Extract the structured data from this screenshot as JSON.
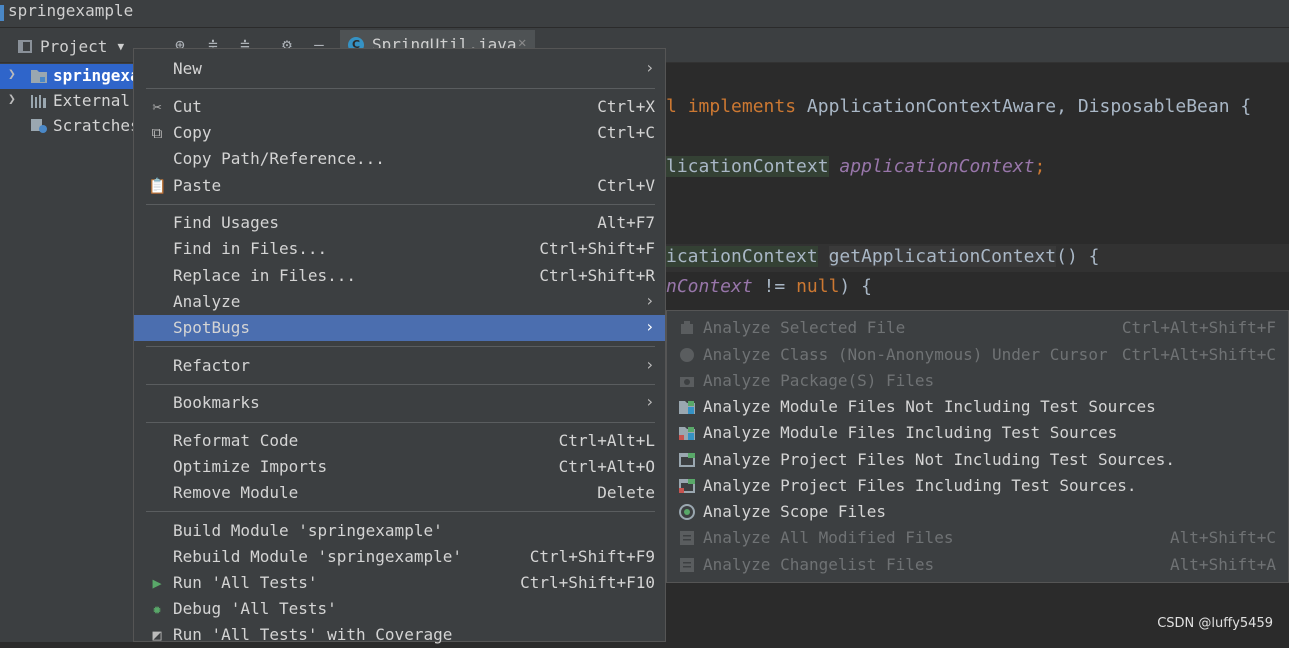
{
  "window": {
    "title": "springexample"
  },
  "toolbar": {
    "project_label": "Project"
  },
  "tab": {
    "icon_letter": "C",
    "name": "SpringUtil.java"
  },
  "tree": [
    {
      "label": "springexa",
      "selected": true
    },
    {
      "label": "External",
      "selected": false
    },
    {
      "label": "Scratches",
      "selected": false
    }
  ],
  "editor": {
    "line1": {
      "implements": "implements",
      "types": " ApplicationContextAware, DisposableBean {",
      "comma": ","
    },
    "line2": {
      "type": "licationContext",
      "field": "applicationContext",
      "semi": ";"
    },
    "line3": {
      "type": "icationContext",
      "method": "getApplicationContext",
      "rest": "() {"
    },
    "line4": {
      "field": "nContext",
      "op": " != ",
      "null": "null",
      "rest": ") {"
    }
  },
  "context_menu": {
    "new": {
      "label": "New"
    },
    "cut": {
      "label": "Cut",
      "shortcut": "Ctrl+X"
    },
    "copy": {
      "label": "Copy",
      "shortcut": "Ctrl+C"
    },
    "copy_path": {
      "label": "Copy Path/Reference..."
    },
    "paste": {
      "label": "Paste",
      "shortcut": "Ctrl+V"
    },
    "find_usages": {
      "label": "Find Usages",
      "shortcut": "Alt+F7"
    },
    "find_in_files": {
      "label": "Find in Files...",
      "shortcut": "Ctrl+Shift+F"
    },
    "replace_in_files": {
      "label": "Replace in Files...",
      "shortcut": "Ctrl+Shift+R"
    },
    "analyze": {
      "label": "Analyze"
    },
    "spotbugs": {
      "label": "SpotBugs"
    },
    "refactor": {
      "label": "Refactor"
    },
    "bookmarks": {
      "label": "Bookmarks"
    },
    "reformat": {
      "label": "Reformat Code",
      "shortcut": "Ctrl+Alt+L"
    },
    "optimize": {
      "label": "Optimize Imports",
      "shortcut": "Ctrl+Alt+O"
    },
    "remove_module": {
      "label": "Remove Module",
      "shortcut": "Delete"
    },
    "build_module": {
      "label": "Build Module 'springexample'"
    },
    "rebuild_module": {
      "label": "Rebuild Module 'springexample'",
      "shortcut": "Ctrl+Shift+F9"
    },
    "run_tests": {
      "label": "Run 'All Tests'",
      "shortcut": "Ctrl+Shift+F10"
    },
    "debug_tests": {
      "label": "Debug 'All Tests'"
    },
    "run_coverage": {
      "label": "Run 'All Tests' with Coverage"
    }
  },
  "spotbugs_menu": {
    "selected_file": {
      "label": "Analyze Selected File",
      "shortcut": "Ctrl+Alt+Shift+F",
      "enabled": false
    },
    "class_cursor": {
      "label": "Analyze Class (Non-Anonymous) Under Cursor",
      "shortcut": "Ctrl+Alt+Shift+C",
      "enabled": false
    },
    "package_files": {
      "label": "Analyze Package(S) Files",
      "enabled": false
    },
    "module_no_tests": {
      "label": "Analyze Module Files Not Including Test Sources",
      "enabled": true
    },
    "module_tests": {
      "label": "Analyze Module Files Including Test Sources",
      "enabled": true
    },
    "project_no_tests": {
      "label": "Analyze Project Files Not Including Test Sources.",
      "enabled": true
    },
    "project_tests": {
      "label": "Analyze Project Files Including Test Sources.",
      "enabled": true
    },
    "scope_files": {
      "label": "Analyze Scope Files",
      "enabled": true
    },
    "modified_files": {
      "label": "Analyze All Modified Files",
      "shortcut": "Alt+Shift+C",
      "enabled": false
    },
    "changelist_files": {
      "label": "Analyze Changelist Files",
      "shortcut": "Alt+Shift+A",
      "enabled": false
    }
  },
  "watermark": "CSDN @luffy5459",
  "colors": {
    "selection": "#4b6eaf",
    "tree_selection": "#2f65ca",
    "menu_bg": "#3c3f41",
    "editor_bg": "#2b2b2b",
    "keyword": "#cc7832",
    "field": "#9876aa"
  }
}
